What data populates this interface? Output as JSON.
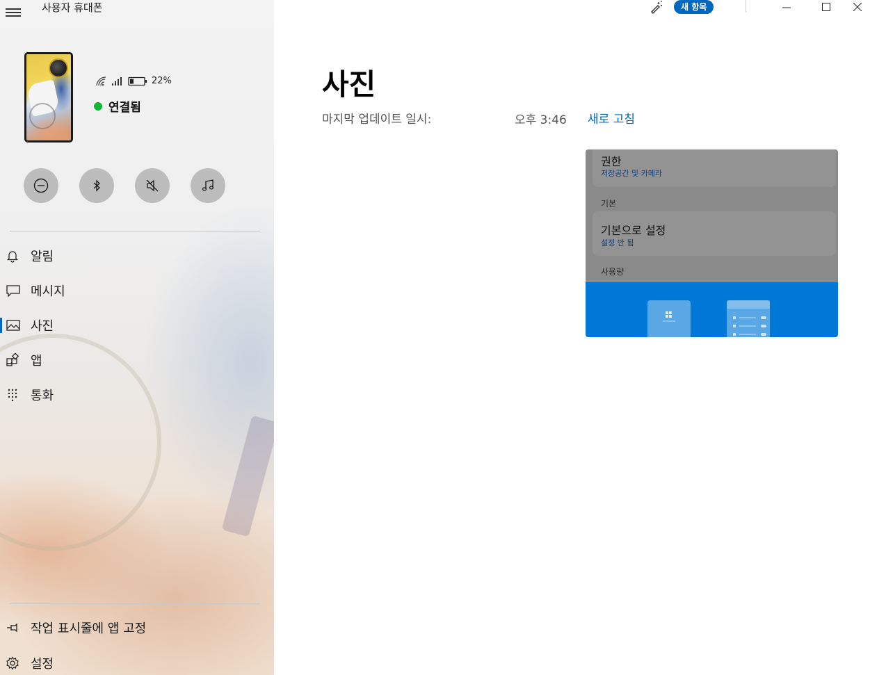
{
  "app": {
    "title": "사용자 휴대폰"
  },
  "device": {
    "battery": "22%",
    "connection_status": "연결됨",
    "status_color": "#10b534"
  },
  "quick_actions": [
    {
      "name": "do-not-disturb",
      "icon": "minus-circle-icon"
    },
    {
      "name": "bluetooth",
      "icon": "bluetooth-icon"
    },
    {
      "name": "mute",
      "icon": "speaker-mute-icon"
    },
    {
      "name": "media",
      "icon": "music-note-icon"
    }
  ],
  "nav": {
    "items": [
      {
        "label": "알림",
        "icon": "bell-icon"
      },
      {
        "label": "메시지",
        "icon": "chat-icon"
      },
      {
        "label": "사진",
        "icon": "photo-icon",
        "active": true
      },
      {
        "label": "앱",
        "icon": "apps-icon"
      },
      {
        "label": "통화",
        "icon": "dialpad-icon"
      }
    ],
    "bottom": [
      {
        "label": "작업 표시줄에 앱 고정",
        "icon": "pin-icon"
      },
      {
        "label": "설정",
        "icon": "gear-icon"
      }
    ]
  },
  "titlebar": {
    "new_badge": "새 항목"
  },
  "main": {
    "title": "사진",
    "last_update_label": "마지막 업데이트 일시:",
    "last_update_time": "오후 3:46",
    "refresh_label": "새로 고침"
  },
  "preview_card": {
    "permission_title": "권한",
    "permission_sub": "저장공간 및 카메라",
    "section_default": "기본",
    "default_title": "기본으로 설정",
    "default_sub": "설정 안 됨",
    "section_usage": "사용량"
  },
  "colors": {
    "accent": "#0067c0",
    "banner": "#0078d7"
  }
}
